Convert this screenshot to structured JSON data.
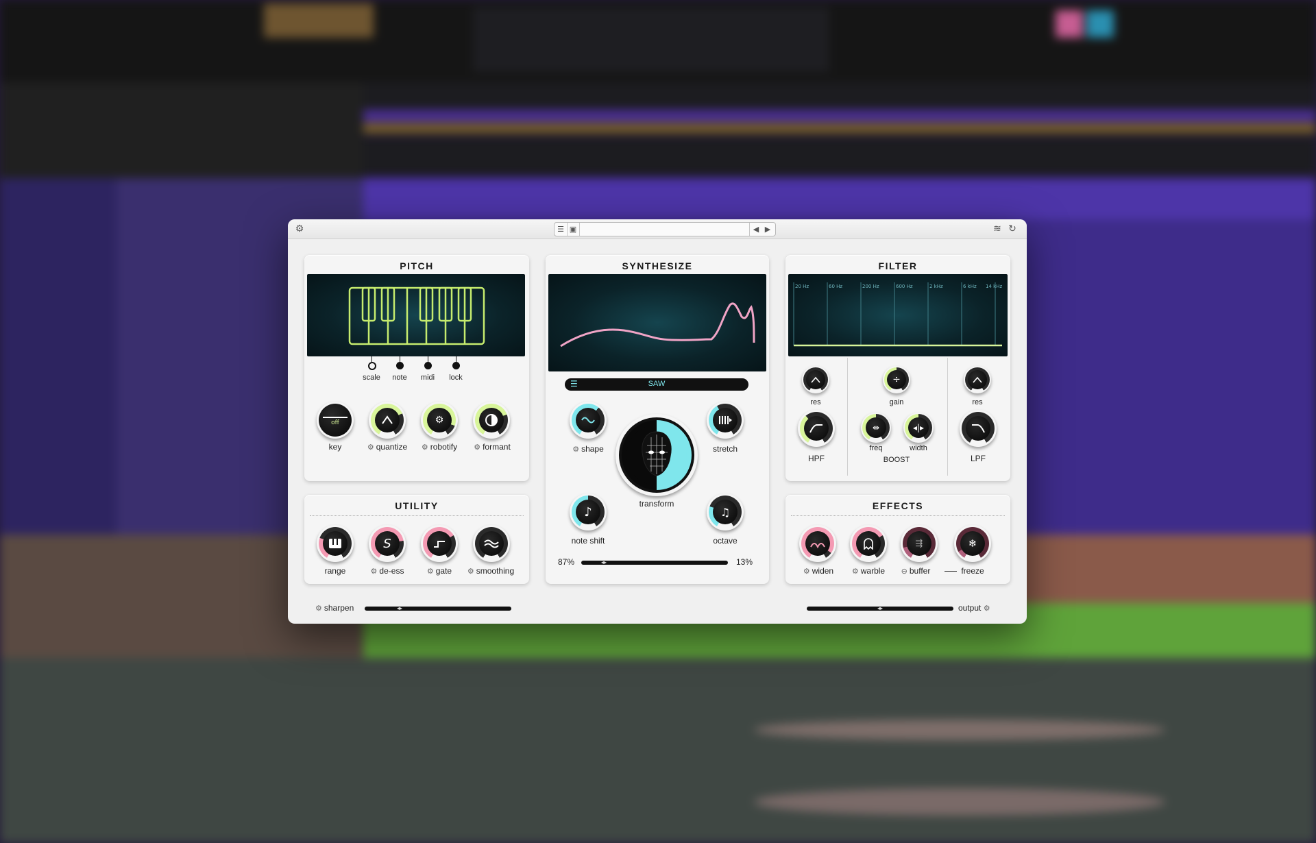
{
  "window": {
    "settings_icon": "gear-icon",
    "preset_name": "",
    "icons": [
      "menu-icon",
      "save-icon",
      "prev-icon",
      "next-icon",
      "layers-icon",
      "undo-icon"
    ]
  },
  "pitch": {
    "title": "PITCH",
    "switches": [
      {
        "label": "scale"
      },
      {
        "label": "note"
      },
      {
        "label": "midi"
      },
      {
        "label": "lock"
      }
    ],
    "knobs": [
      {
        "label": "key",
        "value_text": "off",
        "level": 0.0
      },
      {
        "label": "quantize",
        "level": 0.6
      },
      {
        "label": "robotify",
        "level": 0.85
      },
      {
        "label": "formant",
        "level": 0.7
      }
    ]
  },
  "synthesize": {
    "title": "SYNTHESIZE",
    "waveform": "SAW",
    "knobs": [
      {
        "label": "shape",
        "level": 0.55
      },
      {
        "label": "stretch",
        "level": 0.35
      },
      {
        "label": "transform",
        "level": 0.5
      },
      {
        "label": "note shift",
        "level": 0.45
      },
      {
        "label": "octave",
        "level": 0.25
      }
    ],
    "mix_left": "87%",
    "mix_right": "13%",
    "mix_position": 0.13
  },
  "filter": {
    "title": "FILTER",
    "freq_labels": [
      "20 Hz",
      "60 Hz",
      "200 Hz",
      "600 Hz",
      "2 kHz",
      "6 kHz",
      "14 kHz"
    ],
    "knobs": {
      "hpf_res": "res",
      "gain": "gain",
      "lpf_res": "res",
      "hpf": "HPF",
      "freq": "freq",
      "width": "width",
      "lpf": "LPF"
    },
    "boost_label": "BOOST"
  },
  "utility": {
    "title": "UTILITY",
    "knobs": [
      {
        "label": "range",
        "level": 0.25
      },
      {
        "label": "de-ess",
        "level": 0.75
      },
      {
        "label": "gate",
        "level": 0.7
      },
      {
        "label": "smoothing",
        "level": 0.0
      }
    ],
    "sharpen_label": "sharpen",
    "sharpen_position": 0.22
  },
  "effects": {
    "title": "EFFECTS",
    "knobs": [
      {
        "label": "widen",
        "level": 0.9
      },
      {
        "label": "warble",
        "level": 0.7
      },
      {
        "label": "buffer",
        "level": 0.15
      },
      {
        "label": "freeze",
        "level": 0.1
      }
    ],
    "output_label": "output",
    "output_position": 0.5
  },
  "colors": {
    "green_accent": "#d8f59a",
    "cyan_accent": "#7fe6ec",
    "pink_accent": "#f49ab3",
    "screen_dark": "#0b2329",
    "waveform_pink": "#f0a4c6",
    "piano_green": "#c6ec6e"
  }
}
